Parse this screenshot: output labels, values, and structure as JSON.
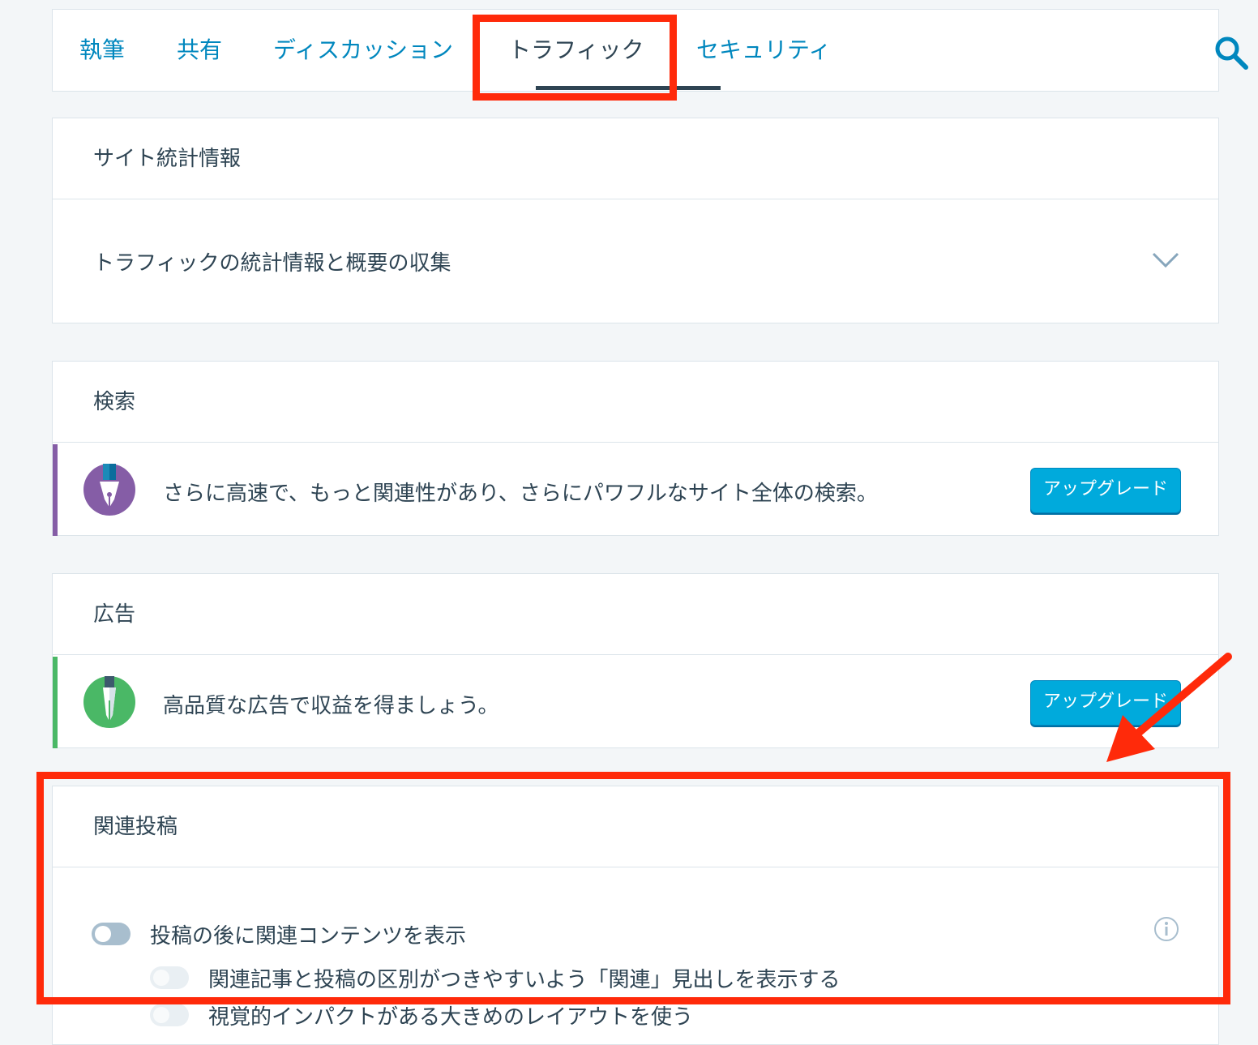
{
  "tabs": [
    {
      "label": "執筆",
      "active": false
    },
    {
      "label": "共有",
      "active": false
    },
    {
      "label": "ディスカッション",
      "active": false
    },
    {
      "label": "トラフィック",
      "active": true
    },
    {
      "label": "セキュリティ",
      "active": false
    }
  ],
  "site_stats": {
    "title": "サイト統計情報",
    "row_label": "トラフィックの統計情報と概要の収集"
  },
  "search": {
    "title": "検索",
    "description": "さらに高速で、もっと関連性があり、さらにパワフルなサイト全体の検索。",
    "button": "アップグレード",
    "accent_color": "#855da6"
  },
  "ads": {
    "title": "広告",
    "description": "高品質な広告で収益を得ましょう。",
    "button": "アップグレード",
    "accent_color": "#4ab866"
  },
  "related_posts": {
    "title": "関連投稿",
    "main_toggle": {
      "label": "投稿の後に関連コンテンツを表示",
      "on": false
    },
    "sub_toggles": [
      {
        "label": "関連記事と投稿の区別がつきやすいよう「関連」見出しを表示する",
        "on": false
      },
      {
        "label": "視覚的インパクトがある大きめのレイアウトを使う",
        "on": false
      }
    ]
  },
  "colors": {
    "link": "#0087be",
    "primary_button": "#00aadc",
    "highlight": "#ff2a0a"
  }
}
